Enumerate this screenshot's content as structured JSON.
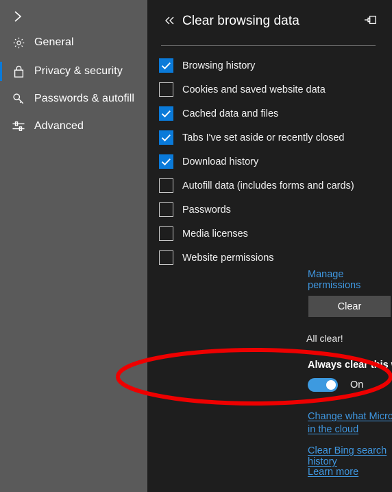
{
  "colors": {
    "accent_blue": "#0a7ad9",
    "toggle_blue": "#3d9ae0",
    "link_blue": "#3f97e0",
    "sidebar_bg": "#5a5a5a",
    "panel_bg": "#1e1e1e",
    "button_bg": "#4c4c4c",
    "annotation_red": "#ee0000"
  },
  "sidebar": {
    "expand_icon": "chevron-right-icon",
    "items": [
      {
        "label": "General",
        "icon": "gear-icon",
        "selected": false
      },
      {
        "label": "Privacy & security",
        "icon": "lock-icon",
        "selected": true
      },
      {
        "label": "Passwords & autofill",
        "icon": "key-icon",
        "selected": false
      },
      {
        "label": "Advanced",
        "icon": "sliders-icon",
        "selected": false
      }
    ]
  },
  "panel": {
    "back_icon": "double-chevron-left-icon",
    "title": "Clear browsing data",
    "pin_icon": "pin-icon",
    "checkboxes": [
      {
        "label": "Browsing history",
        "checked": true
      },
      {
        "label": "Cookies and saved website data",
        "checked": false
      },
      {
        "label": "Cached data and files",
        "checked": true
      },
      {
        "label": "Tabs I've set aside or recently closed",
        "checked": true
      },
      {
        "label": "Download history",
        "checked": true
      },
      {
        "label": "Autofill data (includes forms and cards)",
        "checked": false
      },
      {
        "label": "Passwords",
        "checked": false
      },
      {
        "label": "Media licenses",
        "checked": false
      },
      {
        "label": "Website permissions",
        "checked": false
      }
    ],
    "manage_permissions_link": "Manage permissions",
    "clear_button": "Clear",
    "status_text": "All clear!",
    "always_clear_label": "Always clear this when I close the browser",
    "toggle_state": "On",
    "links": [
      "Change what Microsoft Edge knows about me in the cloud",
      "Clear Bing search history",
      "Learn more"
    ]
  },
  "annotation": {
    "shape": "red-ellipse-highlight",
    "target": "always-clear-toggle"
  }
}
